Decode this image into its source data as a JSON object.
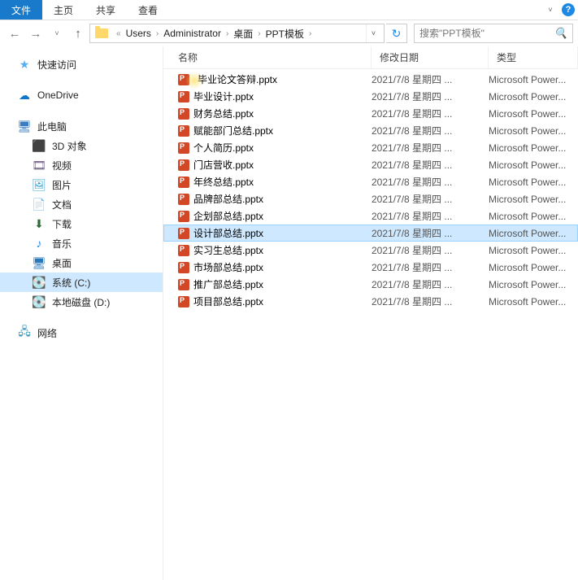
{
  "ribbon": {
    "file": "文件",
    "tabs": [
      "主页",
      "共享",
      "查看"
    ]
  },
  "nav": {
    "breadcrumbs": [
      "Users",
      "Administrator",
      "桌面",
      "PPT模板"
    ],
    "search_placeholder": "搜索\"PPT模板\""
  },
  "sidebar": {
    "quick": "快速访问",
    "onedrive": "OneDrive",
    "thispc": "此电脑",
    "items": [
      {
        "label": "3D 对象"
      },
      {
        "label": "视频"
      },
      {
        "label": "图片"
      },
      {
        "label": "文档"
      },
      {
        "label": "下载"
      },
      {
        "label": "音乐"
      },
      {
        "label": "桌面"
      },
      {
        "label": "系统 (C:)"
      },
      {
        "label": "本地磁盘 (D:)"
      }
    ],
    "network": "网络"
  },
  "columns": {
    "name": "名称",
    "modified": "修改日期",
    "type": "类型"
  },
  "files": [
    {
      "name": "毕业论文答辩.pptx",
      "modified": "2021/7/8 星期四 ...",
      "type": "Microsoft Power...",
      "sel": false,
      "cursor": true
    },
    {
      "name": "毕业设计.pptx",
      "modified": "2021/7/8 星期四 ...",
      "type": "Microsoft Power...",
      "sel": false,
      "cursoroffset": true
    },
    {
      "name": "财务总结.pptx",
      "modified": "2021/7/8 星期四 ...",
      "type": "Microsoft Power...",
      "sel": false
    },
    {
      "name": "赋能部门总结.pptx",
      "modified": "2021/7/8 星期四 ...",
      "type": "Microsoft Power...",
      "sel": false
    },
    {
      "name": "个人简历.pptx",
      "modified": "2021/7/8 星期四 ...",
      "type": "Microsoft Power...",
      "sel": false
    },
    {
      "name": "门店营收.pptx",
      "modified": "2021/7/8 星期四 ...",
      "type": "Microsoft Power...",
      "sel": false
    },
    {
      "name": "年终总结.pptx",
      "modified": "2021/7/8 星期四 ...",
      "type": "Microsoft Power...",
      "sel": false
    },
    {
      "name": "品牌部总结.pptx",
      "modified": "2021/7/8 星期四 ...",
      "type": "Microsoft Power...",
      "sel": false
    },
    {
      "name": "企划部总结.pptx",
      "modified": "2021/7/8 星期四 ...",
      "type": "Microsoft Power...",
      "sel": false
    },
    {
      "name": "设计部总结.pptx",
      "modified": "2021/7/8 星期四 ...",
      "type": "Microsoft Power...",
      "sel": true
    },
    {
      "name": "实习生总结.pptx",
      "modified": "2021/7/8 星期四 ...",
      "type": "Microsoft Power...",
      "sel": false
    },
    {
      "name": "市场部总结.pptx",
      "modified": "2021/7/8 星期四 ...",
      "type": "Microsoft Power...",
      "sel": false
    },
    {
      "name": "推广部总结.pptx",
      "modified": "2021/7/8 星期四 ...",
      "type": "Microsoft Power...",
      "sel": false
    },
    {
      "name": "项目部总结.pptx",
      "modified": "2021/7/8 星期四 ...",
      "type": "Microsoft Power...",
      "sel": false
    }
  ]
}
